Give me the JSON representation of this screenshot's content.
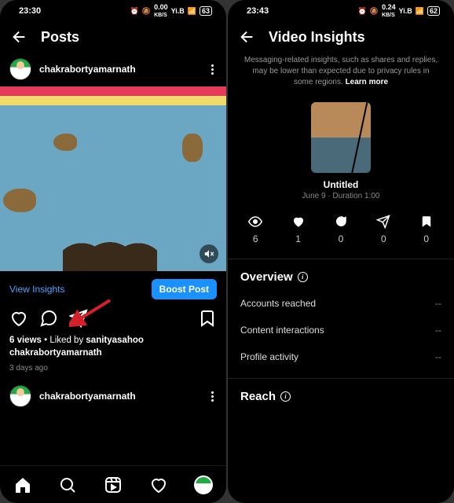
{
  "left": {
    "status": {
      "time": "23:30",
      "net": "0.00",
      "netUnit": "KB/S",
      "carrier": "Yi.B",
      "battery": "63"
    },
    "headerTitle": "Posts",
    "post": {
      "username": "chakrabortyamarnath",
      "viewInsights": "View Insights",
      "boost": "Boost Post",
      "views": "6 views",
      "likedByLabel": "Liked by",
      "likedBy1": "sanityasahoo",
      "likedBy2": "chakrabortyamarnath",
      "age": "3 days ago"
    },
    "post2": {
      "username": "chakrabortyamarnath"
    }
  },
  "right": {
    "status": {
      "time": "23:43",
      "net": "0.24",
      "netUnit": "KB/S",
      "carrier": "Yi.B",
      "battery": "62"
    },
    "headerTitle": "Video Insights",
    "privacy": "Messaging-related insights, such as shares and replies, may be lower than expected due to privacy rules in some regions.",
    "learnMore": "Learn more",
    "video": {
      "title": "Untitled",
      "subtitle": "June 9 · Duration 1:00"
    },
    "stats": {
      "views": "6",
      "likes": "1",
      "comments": "0",
      "shares": "0",
      "saves": "0"
    },
    "overview": {
      "title": "Overview",
      "accounts": {
        "label": "Accounts reached",
        "value": "--"
      },
      "interactions": {
        "label": "Content interactions",
        "value": "--"
      },
      "profile": {
        "label": "Profile activity",
        "value": "--"
      }
    },
    "reach": {
      "title": "Reach"
    }
  }
}
